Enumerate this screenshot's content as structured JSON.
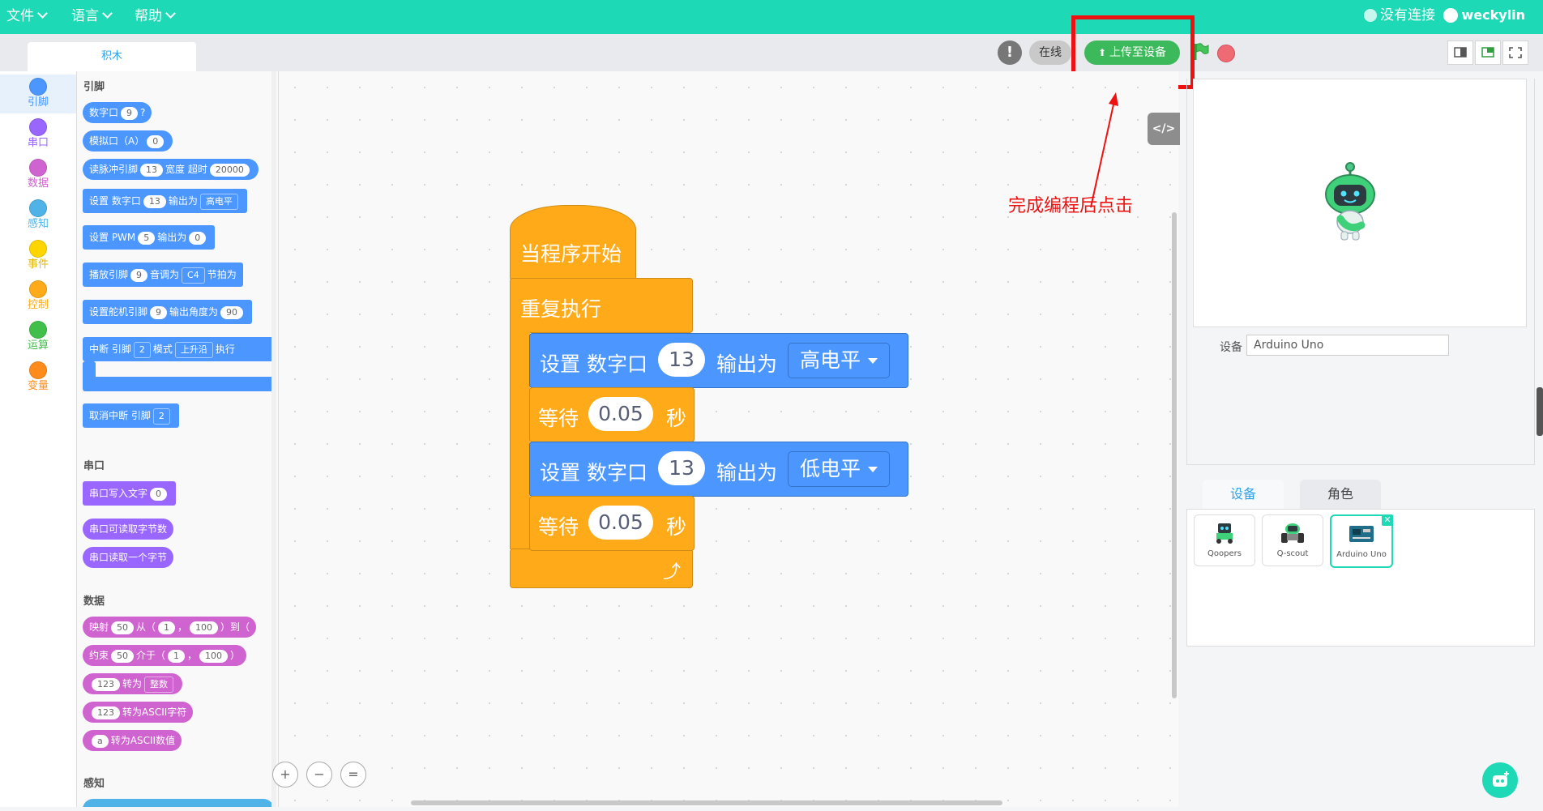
{
  "menu": {
    "file": "文件",
    "language": "语言",
    "help": "帮助",
    "connection_status": "没有连接",
    "username": "weckylin"
  },
  "toolbar": {
    "tab_blocks": "积木",
    "warning_glyph": "!",
    "online": "在线",
    "upload": "上传至设备",
    "code_toggle": "</>"
  },
  "categories": [
    {
      "label": "引脚",
      "color": "#4c97ff"
    },
    {
      "label": "串口",
      "color": "#9966ff"
    },
    {
      "label": "数据",
      "color": "#cf63cf"
    },
    {
      "label": "感知",
      "color": "#4fb3e8"
    },
    {
      "label": "事件",
      "color": "#ffd500"
    },
    {
      "label": "控制",
      "color": "#ffab19"
    },
    {
      "label": "运算",
      "color": "#40bf4a"
    },
    {
      "label": "变量",
      "color": "#ff8c1a"
    }
  ],
  "palette": {
    "pins_header": "引脚",
    "digital_pin": "数字口",
    "digital_pin_val": "9",
    "digital_q": "?",
    "analog_pin": "模拟口（A）",
    "analog_val": "0",
    "pulse_a": "读脉冲引脚",
    "pulse_pin": "13",
    "pulse_b": "宽度 超时",
    "pulse_timeout": "20000",
    "set_dig_a": "设置 数字口",
    "set_dig_pin": "13",
    "set_dig_b": "输出为",
    "set_dig_level": "高电平",
    "pwm_a": "设置 PWM",
    "pwm_pin": "5",
    "pwm_b": "输出为",
    "pwm_val": "0",
    "tone_a": "播放引脚",
    "tone_pin": "9",
    "tone_b": "音调为",
    "tone_note": "C4",
    "tone_c": "节拍为",
    "servo_a": "设置舵机引脚",
    "servo_pin": "9",
    "servo_b": "输出角度为",
    "servo_val": "90",
    "int_a": "中断 引脚",
    "int_pin": "2",
    "int_b": "模式",
    "int_mode": "上升沿",
    "int_c": "执行",
    "cancel_int": "取消中断 引脚",
    "cancel_pin": "2",
    "serial_header": "串口",
    "serial_write": "串口写入文字",
    "serial_write_val": "0",
    "serial_available": "串口可读取字节数",
    "serial_read": "串口读取一个字节",
    "data_header": "数据",
    "map_a": "映射",
    "map_v": "50",
    "map_b": "从（",
    "map_lo": "1",
    "map_c": "，",
    "map_hi": "100",
    "map_d": "）到（",
    "constrain_a": "约束",
    "constrain_v": "50",
    "constrain_b": "介于（",
    "constrain_lo": "1",
    "constrain_c": "，",
    "constrain_hi": "100",
    "constrain_d": "）",
    "convert_v": "123",
    "convert_a": "转为",
    "convert_type": "整数",
    "ascii_v": "123",
    "ascii_a": "转为ASCII字符",
    "ascii_num_v": "a",
    "ascii_num_a": "转为ASCII数值",
    "sensing_header": "感知"
  },
  "script": {
    "hat": "当程序开始",
    "loop": "重复执行",
    "set1_a": "设置 数字口",
    "set1_pin": "13",
    "set1_b": "输出为",
    "set1_level": "高电平",
    "wait1_a": "等待",
    "wait1_val": "0.05",
    "wait1_b": "秒",
    "set2_a": "设置 数字口",
    "set2_pin": "13",
    "set2_b": "输出为",
    "set2_level": "低电平",
    "wait2_a": "等待",
    "wait2_val": "0.05",
    "wait2_b": "秒",
    "loop_arrow": "⤴"
  },
  "zoom": {
    "in": "+",
    "out": "−",
    "reset": "="
  },
  "annotation": "完成编程后点击",
  "device": {
    "label": "设备",
    "value": "Arduino Uno"
  },
  "right_tabs": {
    "devices": "设备",
    "sprites": "角色"
  },
  "devices": [
    {
      "name": "Qoopers"
    },
    {
      "name": "Q-scout"
    },
    {
      "name": "Arduino Uno"
    }
  ],
  "device_remove": "✕"
}
